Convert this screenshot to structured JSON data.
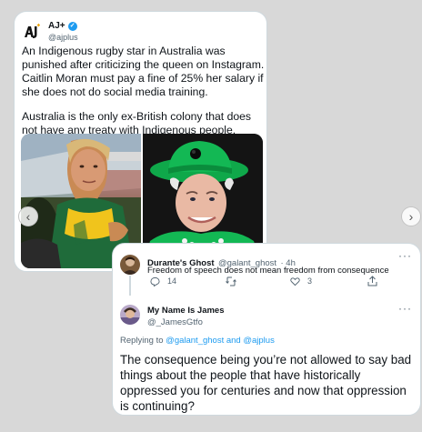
{
  "tweet1": {
    "display_name": "AJ+",
    "handle": "@ajplus",
    "paragraph1": "An Indigenous rugby star in Australia was punished after criticizing the queen on Instagram. Caitlin Moran must pay a fine of 25% her salary if she does not do social media training.",
    "paragraph2": "Australia is the only ex-British colony that does not have any treaty with Indigenous people."
  },
  "nav": {
    "prev": "‹",
    "next": "›"
  },
  "reply1": {
    "display_name": "Durante's Ghost",
    "handle": "@galant_ghost",
    "time": "· 4h",
    "text": "Freedom of speech does not mean freedom from consequence",
    "replies": "14",
    "likes": "3"
  },
  "reply2": {
    "display_name": "My Name Is James",
    "handle": "@_JamesGtfo",
    "replying_prefix": "Replying to",
    "replying_to": "@galant_ghost and @ajplus",
    "text": "The consequence being you’re not allowed to say bad things about the people that have historically oppressed you for centuries and now that oppression is continuing?"
  },
  "icons": [
    "aj-logo",
    "verified-badge",
    "reply-icon",
    "retweet-icon",
    "like-icon",
    "share-icon",
    "more-icon",
    "chevron-left-icon",
    "chevron-right-icon"
  ],
  "colors": {
    "link": "#1d9bf0",
    "secondary_text": "#536471",
    "border": "#cfd9de",
    "background": "#d8d8d8"
  }
}
